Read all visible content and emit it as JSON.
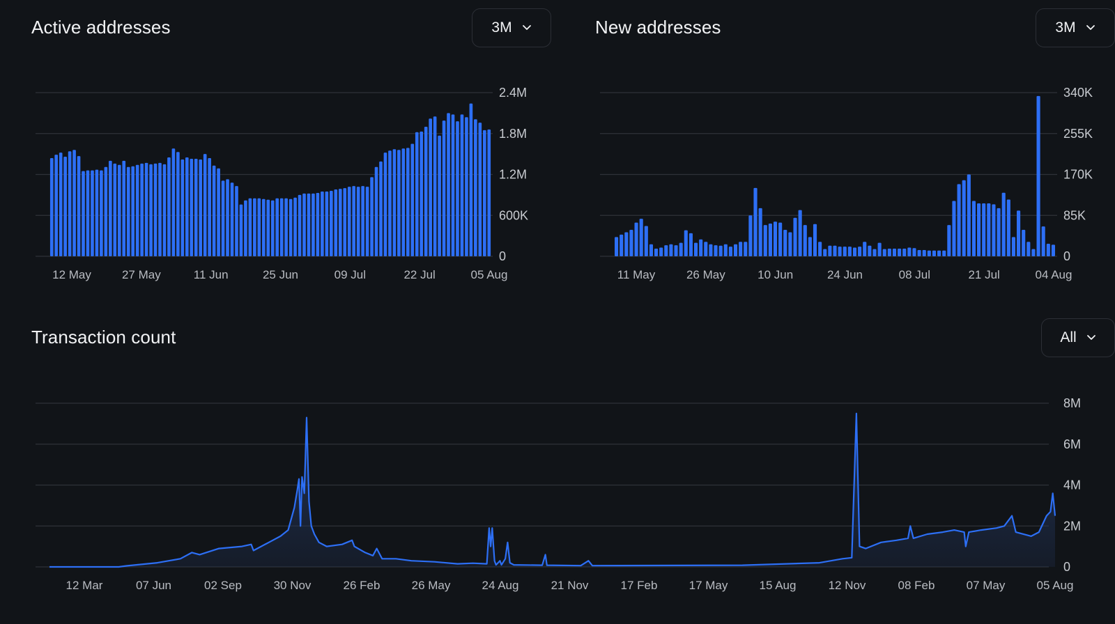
{
  "colors": {
    "background": "#111418",
    "accent": "#2d6ff5",
    "grid": "#2f3238",
    "axis_text": "#c9ccd1",
    "area_fill_top": "#22345a"
  },
  "active_addresses": {
    "title": "Active addresses",
    "range_label": "3M",
    "range_icon": "chevron-down-icon"
  },
  "new_addresses": {
    "title": "New addresses",
    "range_label": "3M",
    "range_icon": "chevron-down-icon"
  },
  "transaction_count": {
    "title": "Transaction count",
    "range_label": "All",
    "range_icon": "chevron-down-icon"
  },
  "chart_data": [
    {
      "type": "bar",
      "title": "Active addresses",
      "x_tick_labels": [
        "12 May",
        "27 May",
        "11 Jun",
        "25 Jun",
        "09 Jul",
        "22 Jul",
        "05 Aug"
      ],
      "y_ticks": [
        0,
        600000,
        1200000,
        1800000,
        2400000
      ],
      "y_tick_labels": [
        "0",
        "600K",
        "1.2M",
        "1.8M",
        "2.4M"
      ],
      "ylim": [
        0,
        2400000
      ],
      "grid": true,
      "values": [
        1440000,
        1490000,
        1520000,
        1460000,
        1540000,
        1560000,
        1470000,
        1250000,
        1260000,
        1260000,
        1270000,
        1260000,
        1310000,
        1400000,
        1360000,
        1340000,
        1400000,
        1310000,
        1320000,
        1340000,
        1360000,
        1370000,
        1350000,
        1360000,
        1370000,
        1350000,
        1450000,
        1580000,
        1530000,
        1420000,
        1450000,
        1430000,
        1430000,
        1420000,
        1500000,
        1440000,
        1330000,
        1290000,
        1110000,
        1130000,
        1080000,
        1030000,
        760000,
        820000,
        850000,
        850000,
        850000,
        840000,
        830000,
        820000,
        850000,
        850000,
        850000,
        840000,
        860000,
        900000,
        920000,
        920000,
        920000,
        930000,
        950000,
        950000,
        960000,
        980000,
        990000,
        1000000,
        1020000,
        1030000,
        1020000,
        1030000,
        1020000,
        1160000,
        1310000,
        1390000,
        1520000,
        1550000,
        1570000,
        1560000,
        1580000,
        1590000,
        1650000,
        1820000,
        1830000,
        1900000,
        2020000,
        2050000,
        1770000,
        1990000,
        2100000,
        2080000,
        1980000,
        2080000,
        2040000,
        2240000,
        2010000,
        1960000,
        1850000,
        1860000
      ]
    },
    {
      "type": "bar",
      "title": "New addresses",
      "x_tick_labels": [
        "11 May",
        "26 May",
        "10 Jun",
        "24 Jun",
        "08 Jul",
        "21 Jul",
        "04 Aug"
      ],
      "y_ticks": [
        0,
        85000,
        170000,
        255000,
        340000
      ],
      "y_tick_labels": [
        "0",
        "85K",
        "170K",
        "255K",
        "340K"
      ],
      "ylim": [
        0,
        340000
      ],
      "grid": true,
      "values": [
        40000,
        45000,
        50000,
        55000,
        70000,
        78000,
        63000,
        25000,
        16000,
        18000,
        23000,
        25000,
        23000,
        28000,
        54000,
        48000,
        28000,
        35000,
        30000,
        25000,
        23000,
        22000,
        25000,
        20000,
        25000,
        30000,
        30000,
        85000,
        142000,
        100000,
        65000,
        68000,
        72000,
        70000,
        55000,
        50000,
        80000,
        96000,
        65000,
        40000,
        67000,
        30000,
        15000,
        22000,
        22000,
        20000,
        20000,
        20000,
        18000,
        20000,
        30000,
        22000,
        15000,
        28000,
        15000,
        16000,
        16000,
        16000,
        16000,
        18000,
        17000,
        13000,
        13000,
        12000,
        12000,
        12000,
        12000,
        65000,
        115000,
        150000,
        158000,
        170000,
        115000,
        110000,
        110000,
        110000,
        108000,
        100000,
        132000,
        118000,
        40000,
        95000,
        55000,
        30000,
        15000,
        333000,
        62000,
        26000,
        24000
      ]
    },
    {
      "type": "area",
      "title": "Transaction count",
      "x_tick_labels": [
        "12 Mar",
        "07 Jun",
        "02 Sep",
        "30 Nov",
        "26 Feb",
        "26 May",
        "24 Aug",
        "21 Nov",
        "17 Feb",
        "17 May",
        "15 Aug",
        "12 Nov",
        "08 Feb",
        "07 May",
        "05 Aug"
      ],
      "y_ticks": [
        0,
        2000000,
        4000000,
        6000000,
        8000000
      ],
      "y_tick_labels": [
        "0",
        "2M",
        "4M",
        "6M",
        "8M"
      ],
      "ylim": [
        0,
        8000000
      ],
      "grid": true,
      "points": [
        [
          0,
          0
        ],
        [
          90,
          0
        ],
        [
          100,
          50000
        ],
        [
          140,
          200000
        ],
        [
          170,
          400000
        ],
        [
          185,
          700000
        ],
        [
          195,
          600000
        ],
        [
          220,
          900000
        ],
        [
          250,
          1000000
        ],
        [
          262,
          1100000
        ],
        [
          265,
          800000
        ],
        [
          290,
          1300000
        ],
        [
          300,
          1500000
        ],
        [
          310,
          1800000
        ],
        [
          318,
          2900000
        ],
        [
          322,
          3800000
        ],
        [
          324,
          4300000
        ],
        [
          326,
          2000000
        ],
        [
          328,
          4400000
        ],
        [
          331,
          3600000
        ],
        [
          334,
          7300000
        ],
        [
          337,
          3200000
        ],
        [
          340,
          2000000
        ],
        [
          344,
          1600000
        ],
        [
          350,
          1200000
        ],
        [
          360,
          1000000
        ],
        [
          380,
          1100000
        ],
        [
          393,
          1300000
        ],
        [
          396,
          1000000
        ],
        [
          410,
          700000
        ],
        [
          420,
          550000
        ],
        [
          425,
          900000
        ],
        [
          432,
          400000
        ],
        [
          450,
          400000
        ],
        [
          470,
          300000
        ],
        [
          500,
          250000
        ],
        [
          530,
          150000
        ],
        [
          550,
          180000
        ],
        [
          568,
          150000
        ],
        [
          571,
          1900000
        ],
        [
          573,
          1000000
        ],
        [
          575,
          1900000
        ],
        [
          578,
          300000
        ],
        [
          580,
          100000
        ],
        [
          585,
          300000
        ],
        [
          587,
          100000
        ],
        [
          592,
          400000
        ],
        [
          595,
          1200000
        ],
        [
          598,
          200000
        ],
        [
          603,
          100000
        ],
        [
          640,
          80000
        ],
        [
          644,
          600000
        ],
        [
          646,
          80000
        ],
        [
          690,
          60000
        ],
        [
          700,
          300000
        ],
        [
          705,
          60000
        ],
        [
          900,
          80000
        ],
        [
          1000,
          200000
        ],
        [
          1030,
          400000
        ],
        [
          1042,
          450000
        ],
        [
          1048,
          7500000
        ],
        [
          1052,
          1000000
        ],
        [
          1060,
          900000
        ],
        [
          1080,
          1200000
        ],
        [
          1100,
          1300000
        ],
        [
          1115,
          1400000
        ],
        [
          1118,
          2000000
        ],
        [
          1122,
          1400000
        ],
        [
          1140,
          1600000
        ],
        [
          1160,
          1700000
        ],
        [
          1175,
          1800000
        ],
        [
          1188,
          1700000
        ],
        [
          1190,
          1000000
        ],
        [
          1194,
          1700000
        ],
        [
          1210,
          1800000
        ],
        [
          1230,
          1900000
        ],
        [
          1240,
          2000000
        ],
        [
          1250,
          2500000
        ],
        [
          1255,
          1700000
        ],
        [
          1275,
          1500000
        ],
        [
          1285,
          1700000
        ],
        [
          1295,
          2500000
        ],
        [
          1300,
          2700000
        ],
        [
          1303,
          3600000
        ],
        [
          1306,
          2500000
        ]
      ]
    }
  ]
}
